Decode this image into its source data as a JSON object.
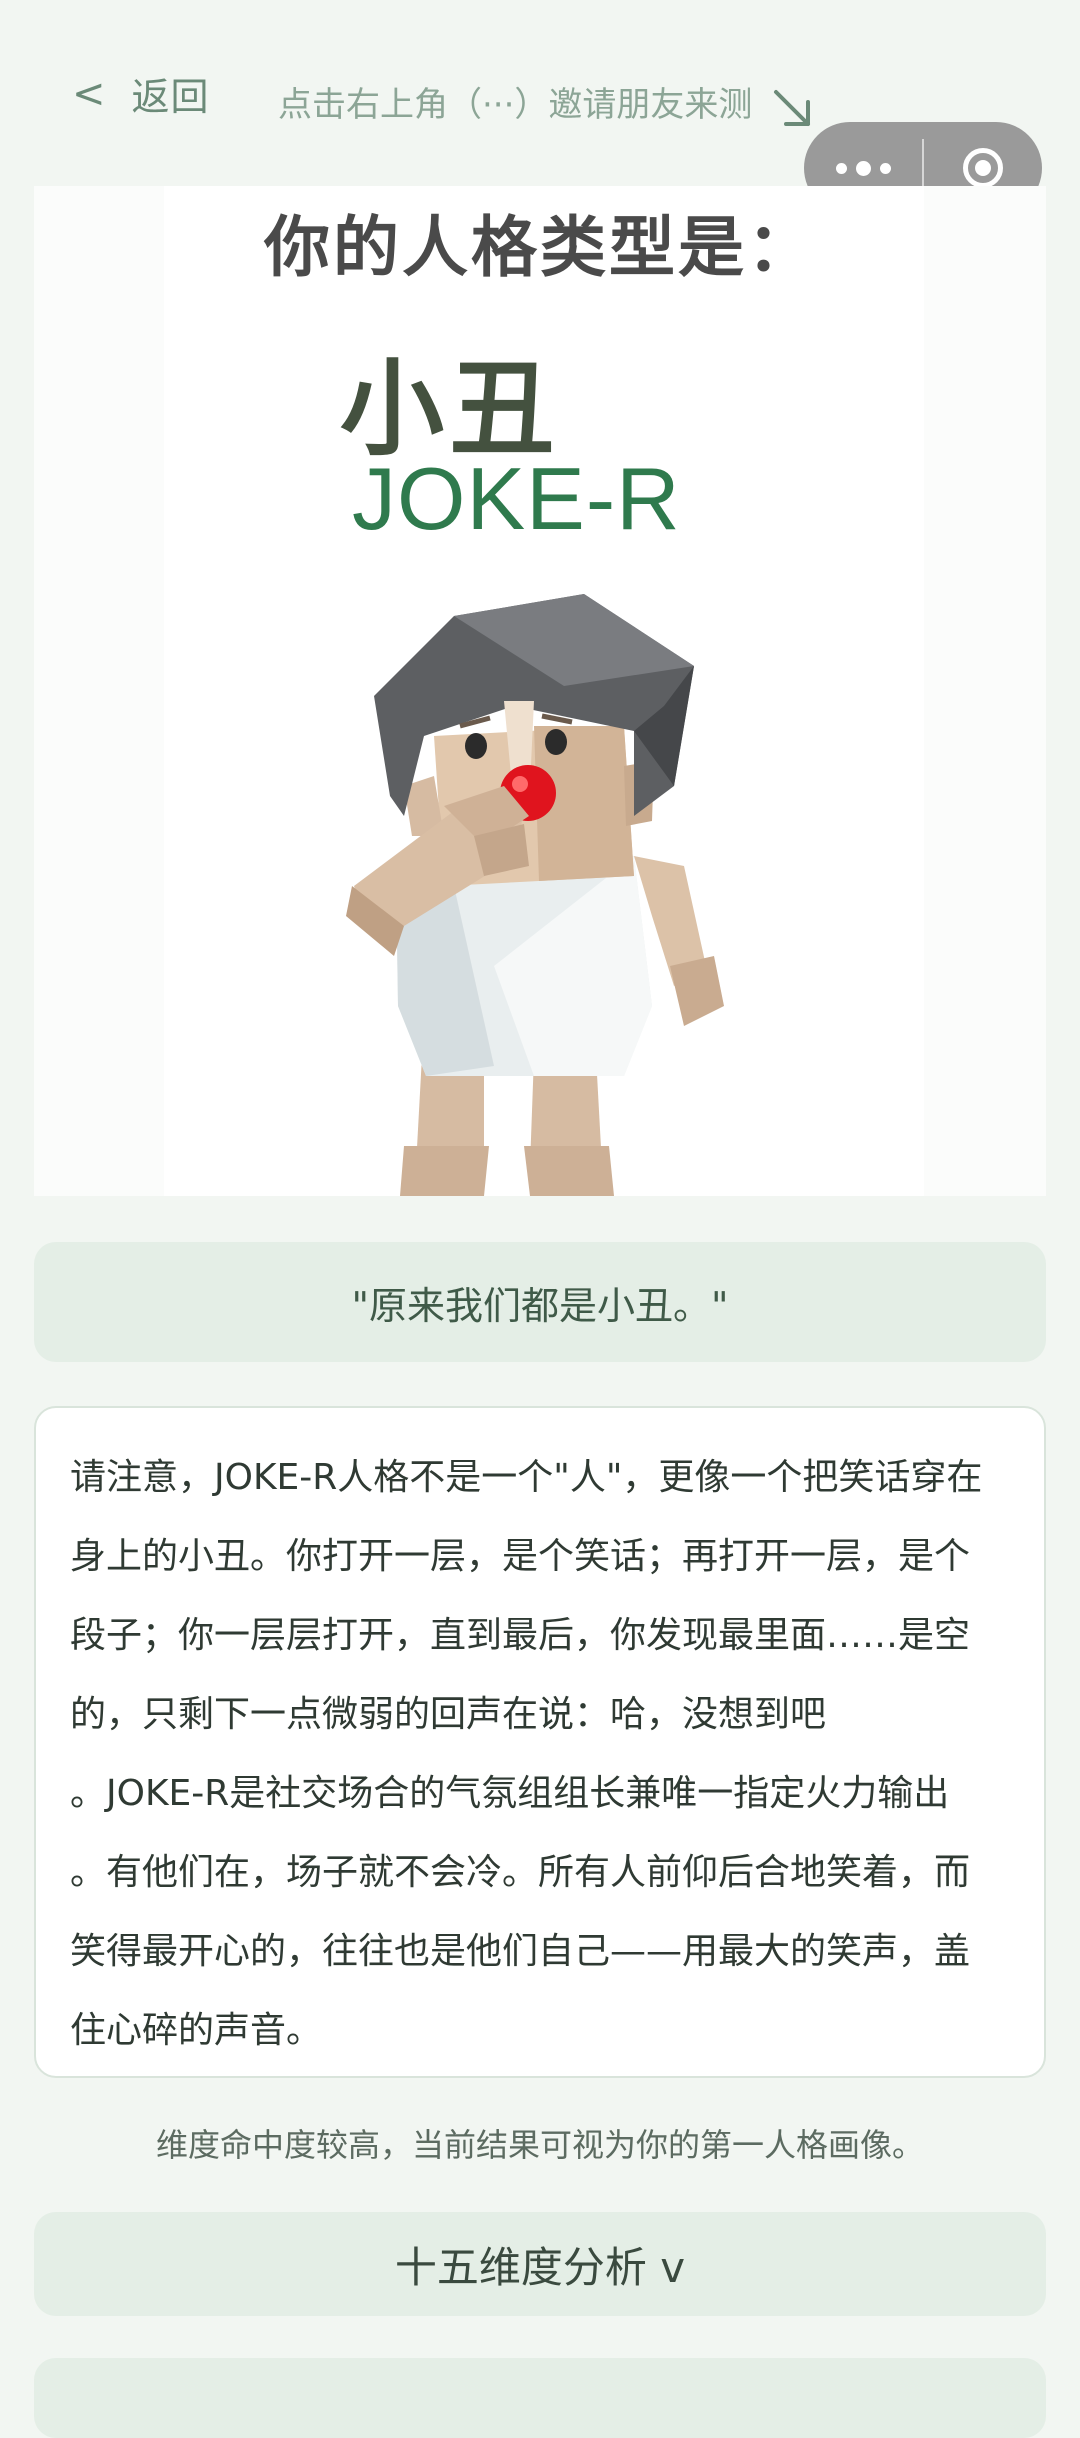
{
  "topbar": {
    "back_icon": "<",
    "back_label": "返回",
    "invite_text": "点击右上角（···）邀请朋友来测",
    "invite_arrow_icon": "arrow-down-right-icon",
    "capsule": {
      "more_icon": "more-dots-icon",
      "close_icon": "target-ring-icon"
    }
  },
  "hero": {
    "heading": "你的人格类型是：",
    "type_name": "小丑",
    "type_code": "JOKE-R"
  },
  "quote": "\"原来我们都是小丑。\"",
  "description": {
    "lines": [
      "请注意，JOKE-R人格不是一个\"人\"，更像一个把笑话穿在",
      "身上的小丑。你打开一层，是个笑话；再打开一层，是个",
      "段子；你一层层打开，直到最后，你发现最里面……是空",
      "的，只剩下一点微弱的回声在说：哈，没想到吧",
      "。JOKE-R是社交场合的气氛组组长兼唯一指定火力输出",
      "。有他们在，场子就不会冷。所有人前仰后合地笑着，而",
      "笑得最开心的，往往也是他们自己——用最大的笑声，盖",
      "住心碎的声音。"
    ]
  },
  "note": "维度命中度较高，当前结果可视为你的第一人格画像。",
  "dimensions_button": "十五维度分析 v",
  "colors": {
    "page_bg": "#f2f6f2",
    "accent_green": "#2f7a4d",
    "panel_green": "#e4eee6",
    "clown_nose": "#e0141e"
  }
}
